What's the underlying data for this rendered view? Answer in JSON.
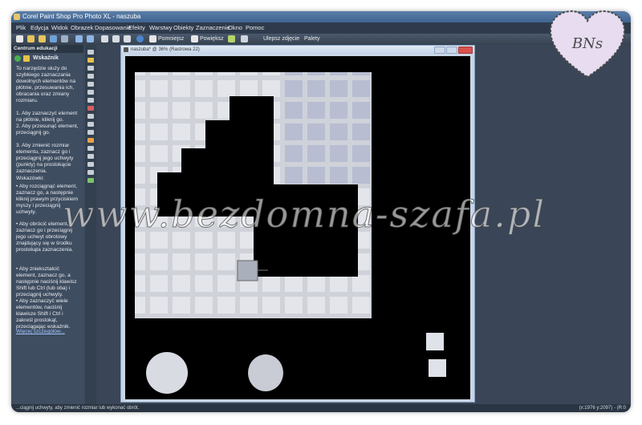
{
  "window": {
    "title": "Corel Paint Shop Pro Photo XL - naszuba"
  },
  "menu": [
    "Plik",
    "Edycja",
    "Widok",
    "Obrazek",
    "Dopasowanie",
    "Efekty",
    "Warstwy",
    "Obiekty",
    "Zaznaczenie",
    "Okno",
    "Pomoc"
  ],
  "toolbar": {
    "pomniejsz": "Pomniejsz",
    "powieksz": "Powiększ",
    "ulepsz": "Ulepsz zdjęcie",
    "palety": "Palety"
  },
  "learning_center": {
    "header": "Centrum edukacji",
    "tool": "Wskaźnik",
    "intro": "To narzędzie służy do szybkiego zaznaczania dowolnych elementów na płótnie, przesuwania ich, obracania oraz zmiany rozmiaru.",
    "steps": [
      "1. Aby zaznaczyć element na płótnie, kliknij go.",
      "2. Aby przesunąć element, przeciągnij go.",
      "3. Aby zmienić rozmiar elementu, zaznacz go i przeciągnij jego uchwyty (punkty) na prostokącie zaznaczenia."
    ],
    "tips_header": "Wskazówki:",
    "tips": [
      "• Aby rozciągnąć element, zaznacz go, a następnie kliknij prawym przyciskiem myszy i przeciągnij uchwyty.",
      "• Aby obrócić element, zaznacz go i przeciągnij jego uchwyt obrotowy znajdujący się w środku prostokąta zaznaczenia.",
      "• Aby zniekształcić element, zaznacz go, a następnie naciśnij klawisz Shift lub Ctrl (lub oba) i przeciągnij uchwyty.",
      "• Aby zaznaczyć wiele elementów, naciśnij klawisze Shift i Ctrl i zakreśl prostokąt, przeciągając wskaźnik."
    ],
    "more": "Więcej szczegółów..."
  },
  "document": {
    "title": "naszuba* @ 36% (Rastrowa 22)"
  },
  "status": {
    "left": "...ciągnij uchwyty, aby zmienić rozmiar lub wykonać obrót.",
    "right": "(x:1976 y:2097) - (R:0"
  },
  "watermark": "www.bezdomna-szafa.pl",
  "stamp": "BNs",
  "colors": {
    "frame": "#3c4a5e",
    "canvas": "#000000",
    "tile_light": "#e3e5ea",
    "tile_blue": "#b8bdd2"
  }
}
